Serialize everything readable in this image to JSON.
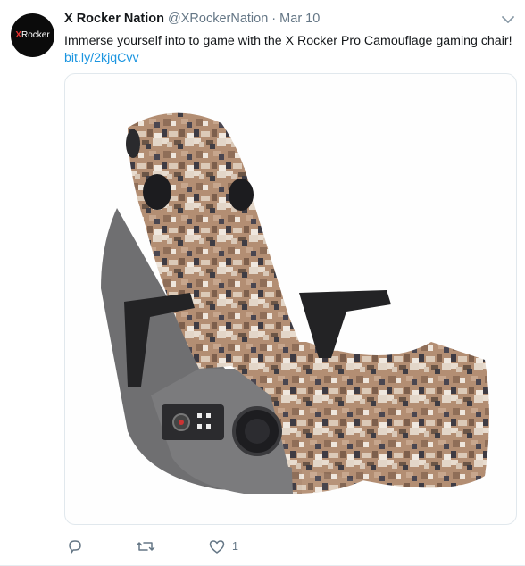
{
  "tweet": {
    "avatar": {
      "logo_x": "X",
      "logo_rest": "Rocker"
    },
    "author_name": "X Rocker Nation",
    "handle": "@XRockerNation",
    "separator": "·",
    "date": "Mar 10",
    "text": "Immerse yourself into to game with the X Rocker Pro Camouflage gaming chair!",
    "link": "bit.ly/2kjqCvv",
    "media": {
      "description_icon": "camouflage-gaming-chair-image"
    },
    "actions": {
      "reply_icon": "reply-icon",
      "retweet_icon": "retweet-icon",
      "like_icon": "heart-icon",
      "like_count": "1"
    }
  },
  "colors": {
    "accent": "#1b95e0",
    "text": "#14171a",
    "muted": "#657786",
    "border": "#e1e8ed",
    "logo_red": "#e8302f"
  }
}
